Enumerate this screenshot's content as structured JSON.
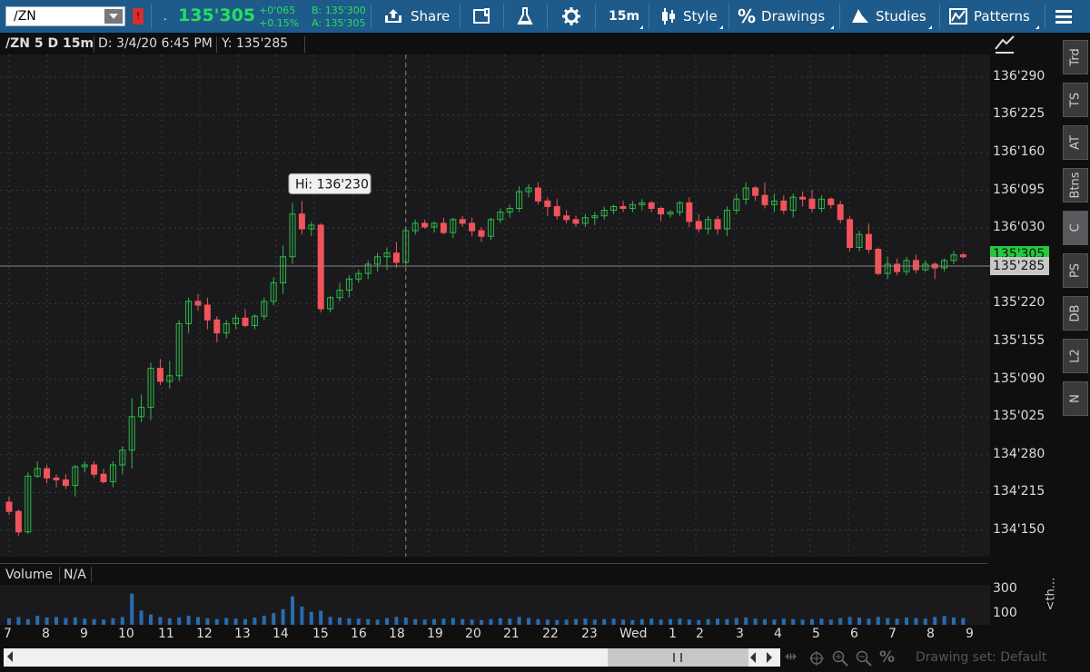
{
  "toolbar": {
    "symbol": "/ZN",
    "badge": "!",
    "dot": ".",
    "last_price": "135'305",
    "change_abs": "+0'065",
    "change_pct": "+0.15%",
    "bid": "B: 135'300",
    "ask": "A: 135'305",
    "share_label": "Share",
    "timeframe_label": "15m",
    "style_label": "Style",
    "drawings_label": "Drawings",
    "studies_label": "Studies",
    "patterns_label": "Patterns"
  },
  "chart_header": {
    "title": "/ZN 5 D 15m",
    "date": "D: 3/4/20 6:45 PM",
    "y_value": "Y: 135'285"
  },
  "hi_label": "Hi: 136'230",
  "current_price_tag": "135'305",
  "crosshair_price_tag": "135'285",
  "sidebar_tabs": [
    "Trd",
    "TS",
    "AT",
    "Btns",
    "C",
    "PS",
    "DB",
    "L2",
    "N"
  ],
  "volume": {
    "title": "Volume",
    "value": "N/A",
    "axis_labels": [
      "300",
      "100"
    ],
    "collapse_label": "<th..."
  },
  "bottom": {
    "drawing_set_label": "Drawing set: Default"
  },
  "chart_data": {
    "type": "candlestick",
    "y_axis_labels": [
      "136'290",
      "136'225",
      "136'160",
      "136'095",
      "136'030",
      "135'305",
      "135'220",
      "135'155",
      "135'090",
      "135'025",
      "134'280",
      "134'215",
      "134'150"
    ],
    "x_axis_labels": [
      "7",
      "8",
      "9",
      "10",
      "11",
      "12",
      "13",
      "14",
      "15",
      "16",
      "18",
      "19",
      "20",
      "21",
      "22",
      "23",
      "Wed",
      "1",
      "2",
      "3",
      "4",
      "5",
      "6",
      "7",
      "8",
      "9"
    ],
    "y_ticks": [
      136.90625,
      136.703125,
      136.5,
      136.296875,
      136.09375,
      135.890625,
      135.6875,
      135.484375,
      135.28125,
      135.078125,
      134.875,
      134.671875,
      134.46875
    ],
    "ylim": [
      134.4,
      136.94
    ],
    "up_color": "#2fb84a",
    "down_color": "#f0545a",
    "grid": true,
    "candles": [
      [
        134.62,
        134.65,
        134.55,
        134.57
      ],
      [
        134.57,
        134.58,
        134.44,
        134.46
      ],
      [
        134.46,
        134.78,
        134.45,
        134.76
      ],
      [
        134.76,
        134.84,
        134.75,
        134.8
      ],
      [
        134.8,
        134.82,
        134.72,
        134.75
      ],
      [
        134.75,
        134.77,
        134.7,
        134.74
      ],
      [
        134.74,
        134.77,
        134.69,
        134.71
      ],
      [
        134.71,
        134.82,
        134.65,
        134.81
      ],
      [
        134.81,
        134.84,
        134.78,
        134.82
      ],
      [
        134.82,
        134.84,
        134.75,
        134.77
      ],
      [
        134.77,
        134.8,
        134.72,
        134.73
      ],
      [
        134.73,
        134.84,
        134.7,
        134.82
      ],
      [
        134.82,
        134.92,
        134.77,
        134.9
      ],
      [
        134.9,
        135.18,
        134.8,
        135.08
      ],
      [
        135.08,
        135.2,
        135.05,
        135.13
      ],
      [
        135.13,
        135.37,
        135.06,
        135.34
      ],
      [
        135.34,
        135.39,
        135.25,
        135.27
      ],
      [
        135.27,
        135.38,
        135.23,
        135.3
      ],
      [
        135.3,
        135.6,
        135.27,
        135.58
      ],
      [
        135.58,
        135.72,
        135.53,
        135.7
      ],
      [
        135.7,
        135.74,
        135.65,
        135.68
      ],
      [
        135.68,
        135.72,
        135.55,
        135.6
      ],
      [
        135.6,
        135.62,
        135.48,
        135.53
      ],
      [
        135.53,
        135.6,
        135.5,
        135.58
      ],
      [
        135.58,
        135.63,
        135.55,
        135.61
      ],
      [
        135.61,
        135.66,
        135.56,
        135.57
      ],
      [
        135.57,
        135.63,
        135.55,
        135.62
      ],
      [
        135.62,
        135.72,
        135.6,
        135.7
      ],
      [
        135.7,
        135.83,
        135.68,
        135.8
      ],
      [
        135.8,
        136.0,
        135.74,
        135.94
      ],
      [
        135.94,
        136.23,
        135.9,
        136.17
      ],
      [
        136.17,
        136.24,
        136.06,
        136.09
      ],
      [
        136.09,
        136.13,
        136.05,
        136.11
      ],
      [
        136.11,
        136.12,
        135.64,
        135.66
      ],
      [
        135.66,
        135.73,
        135.64,
        135.72
      ],
      [
        135.72,
        135.8,
        135.7,
        135.76
      ],
      [
        135.76,
        135.84,
        135.72,
        135.82
      ],
      [
        135.82,
        135.87,
        135.8,
        135.85
      ],
      [
        135.85,
        135.92,
        135.82,
        135.9
      ],
      [
        135.9,
        135.96,
        135.86,
        135.94
      ],
      [
        135.94,
        135.99,
        135.87,
        135.96
      ],
      [
        135.96,
        136.02,
        135.88,
        135.91
      ],
      [
        135.91,
        136.1,
        135.89,
        136.08
      ],
      [
        136.08,
        136.14,
        136.06,
        136.12
      ],
      [
        136.12,
        136.14,
        136.09,
        136.1
      ],
      [
        136.1,
        136.13,
        136.07,
        136.12
      ],
      [
        136.12,
        136.15,
        136.06,
        136.07
      ],
      [
        136.07,
        136.15,
        136.04,
        136.14
      ],
      [
        136.14,
        136.16,
        136.1,
        136.12
      ],
      [
        136.12,
        136.15,
        136.05,
        136.08
      ],
      [
        136.08,
        136.1,
        136.02,
        136.05
      ],
      [
        136.05,
        136.15,
        136.03,
        136.14
      ],
      [
        136.14,
        136.2,
        136.12,
        136.18
      ],
      [
        136.18,
        136.22,
        136.15,
        136.2
      ],
      [
        136.2,
        136.32,
        136.18,
        136.29
      ],
      [
        136.29,
        136.33,
        136.26,
        136.31
      ],
      [
        136.31,
        136.34,
        136.22,
        136.24
      ],
      [
        136.24,
        136.26,
        136.16,
        136.21
      ],
      [
        136.21,
        136.25,
        136.14,
        136.16
      ],
      [
        136.16,
        136.19,
        136.12,
        136.14
      ],
      [
        136.14,
        136.16,
        136.1,
        136.12
      ],
      [
        136.12,
        136.17,
        136.1,
        136.15
      ],
      [
        136.15,
        136.18,
        136.11,
        136.16
      ],
      [
        136.16,
        136.21,
        136.14,
        136.19
      ],
      [
        136.19,
        136.22,
        136.17,
        136.21
      ],
      [
        136.21,
        136.24,
        136.18,
        136.2
      ],
      [
        136.2,
        136.24,
        136.18,
        136.22
      ],
      [
        136.22,
        136.25,
        136.19,
        136.23
      ],
      [
        136.23,
        136.24,
        136.18,
        136.2
      ],
      [
        136.2,
        136.21,
        136.13,
        136.17
      ],
      [
        136.17,
        136.19,
        136.15,
        136.18
      ],
      [
        136.18,
        136.24,
        136.16,
        136.23
      ],
      [
        136.23,
        136.26,
        136.1,
        136.13
      ],
      [
        136.13,
        136.17,
        136.07,
        136.09
      ],
      [
        136.09,
        136.16,
        136.06,
        136.14
      ],
      [
        136.14,
        136.16,
        136.06,
        136.09
      ],
      [
        136.09,
        136.21,
        136.05,
        136.19
      ],
      [
        136.19,
        136.28,
        136.17,
        136.25
      ],
      [
        136.25,
        136.34,
        136.22,
        136.31
      ],
      [
        136.31,
        136.32,
        136.24,
        136.27
      ],
      [
        136.27,
        136.34,
        136.2,
        136.22
      ],
      [
        136.22,
        136.28,
        136.18,
        136.24
      ],
      [
        136.24,
        136.27,
        136.17,
        136.19
      ],
      [
        136.19,
        136.28,
        136.15,
        136.26
      ],
      [
        136.26,
        136.29,
        136.21,
        136.25
      ],
      [
        136.25,
        136.3,
        136.18,
        136.2
      ],
      [
        136.2,
        136.27,
        136.18,
        136.25
      ],
      [
        136.25,
        136.26,
        136.2,
        136.22
      ],
      [
        136.22,
        136.24,
        136.12,
        136.14
      ],
      [
        136.14,
        136.16,
        135.97,
        135.99
      ],
      [
        135.99,
        136.08,
        135.97,
        136.06
      ],
      [
        136.06,
        136.12,
        135.96,
        135.98
      ],
      [
        135.98,
        135.99,
        135.84,
        135.85
      ],
      [
        135.85,
        135.94,
        135.82,
        135.9
      ],
      [
        135.9,
        135.93,
        135.84,
        135.86
      ],
      [
        135.86,
        135.94,
        135.84,
        135.92
      ],
      [
        135.92,
        135.95,
        135.85,
        135.87
      ],
      [
        135.87,
        135.92,
        135.86,
        135.9
      ],
      [
        135.9,
        135.91,
        135.82,
        135.88
      ],
      [
        135.88,
        135.93,
        135.86,
        135.92
      ],
      [
        135.92,
        135.97,
        135.9,
        135.95
      ],
      [
        135.95,
        135.96,
        135.93,
        135.94
      ]
    ],
    "volumes": [
      25,
      30,
      22,
      35,
      28,
      30,
      26,
      28,
      24,
      22,
      20,
      25,
      30,
      120,
      55,
      40,
      30,
      25,
      28,
      35,
      30,
      25,
      22,
      26,
      24,
      22,
      28,
      35,
      45,
      60,
      110,
      70,
      50,
      55,
      30,
      28,
      25,
      24,
      22,
      20,
      26,
      30,
      28,
      22,
      20,
      22,
      24,
      26,
      22,
      20,
      18,
      22,
      25,
      24,
      30,
      26,
      22,
      20,
      18,
      20,
      22,
      24,
      20,
      22,
      24,
      20,
      18,
      22,
      24,
      20,
      22,
      24,
      20,
      18,
      22,
      24,
      22,
      26,
      28,
      24,
      22,
      20,
      24,
      22,
      20,
      22,
      24,
      20,
      26,
      30,
      28,
      24,
      30,
      26,
      24,
      28,
      26,
      24,
      30,
      34,
      28,
      26
    ],
    "hi_index": 30,
    "crosshair_x_index": 42,
    "crosshair_price": 135.89,
    "last_price": 135.953
  }
}
